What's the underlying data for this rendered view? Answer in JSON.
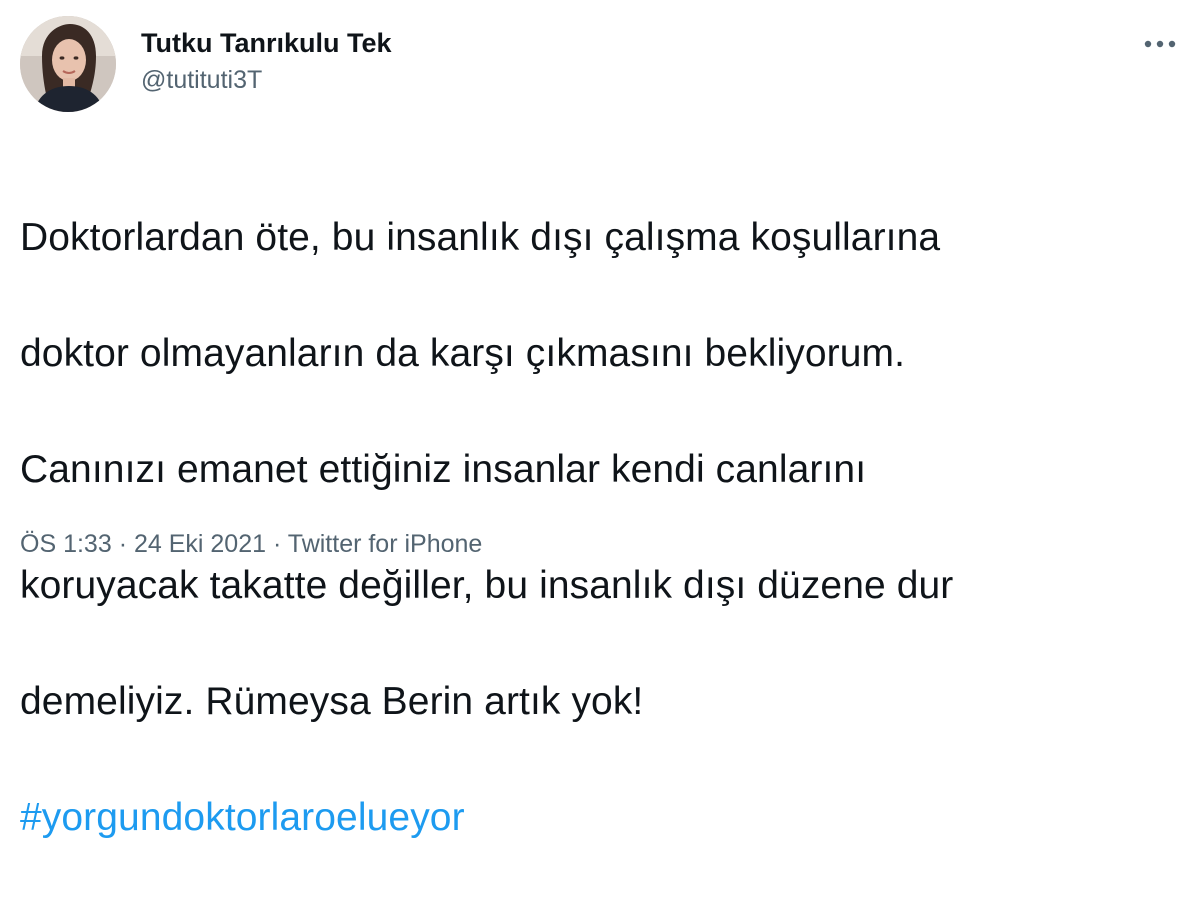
{
  "author": {
    "display_name": "Tutku Tanrıkulu Tek",
    "handle": "@tutituti3T"
  },
  "tweet": {
    "text_lines": [
      "Doktorlardan öte, bu insanlık dışı çalışma koşullarına",
      "doktor olmayanların da karşı çıkmasını bekliyorum.",
      "Canınızı emanet ettiğiniz insanlar kendi canlarını",
      "koruyacak takatte değiller, bu insanlık dışı düzene dur",
      "demeliyiz. Rümeysa Berin artık yok!"
    ],
    "hashtag": "#yorgundoktorlaroelueyor"
  },
  "meta": {
    "time": "ÖS 1:33",
    "separator": "·",
    "date": "24 Eki 2021",
    "source": "Twitter for iPhone"
  },
  "icons": {
    "more": "more-horizontal-icon"
  },
  "colors": {
    "text": "#0f1419",
    "secondary": "#536471",
    "link": "#1d9bf0"
  }
}
